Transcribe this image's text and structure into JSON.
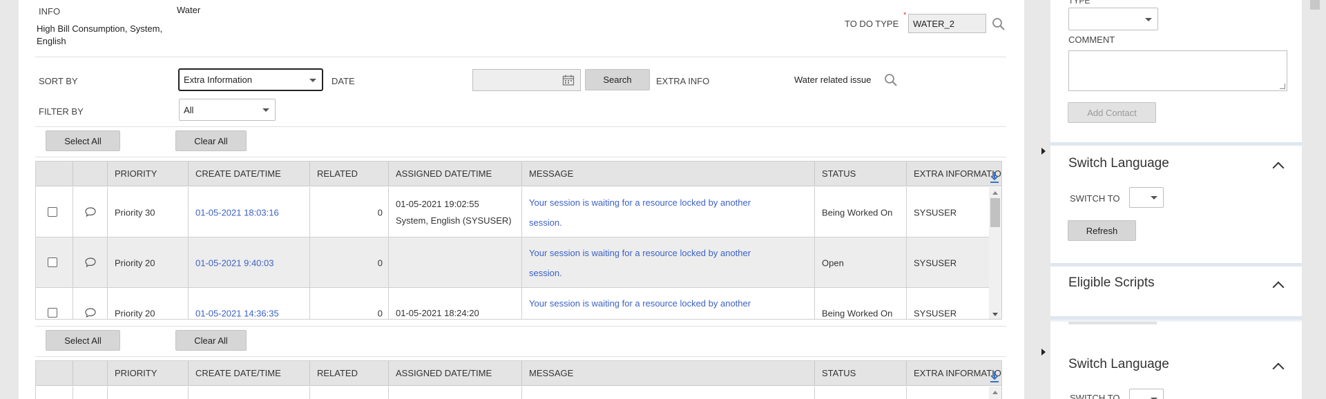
{
  "filters": {
    "info_label": "INFO",
    "info_type": "Water",
    "info_value": "High Bill Consumption, System, English",
    "todo_type_label": "TO DO TYPE",
    "todo_type_required": "*",
    "todo_type_value": "WATER_2",
    "sort_by_label": "SORT BY",
    "sort_by_value": "Extra Information",
    "date_label": "DATE",
    "search_button": "Search",
    "extra_info_label": "EXTRA INFO",
    "extra_info_value": "Water related issue",
    "filter_by_label": "FILTER BY",
    "filter_by_value": "All"
  },
  "actions": {
    "select_all": "Select All",
    "clear_all": "Clear All"
  },
  "table": {
    "columns": [
      "PRIORITY",
      "CREATE DATE/TIME",
      "RELATED",
      "ASSIGNED DATE/TIME",
      "MESSAGE",
      "STATUS",
      "EXTRA INFORMATION"
    ],
    "rows": [
      {
        "priority": "Priority 30",
        "create": "01-05-2021 18:03:16",
        "related": "0",
        "assigned": "01-05-2021 19:02:55",
        "assigned_by": "System, English (SYSUSER)",
        "message": "Your session is waiting for a resource locked by another session.",
        "status": "Being Worked On",
        "extra": "SYSUSER"
      },
      {
        "priority": "Priority 20",
        "create": "01-05-2021 9:40:03",
        "related": "0",
        "assigned": "",
        "assigned_by": "",
        "message": "Your session is waiting for a resource locked by another session.",
        "status": "Open",
        "extra": "SYSUSER"
      },
      {
        "priority": "Priority 20",
        "create": "01-05-2021 14:36:35",
        "related": "0",
        "assigned": "01-05-2021 18:24:20",
        "assigned_by": "",
        "message": "Your session is waiting for a resource locked by another session.",
        "status": "Being Worked On",
        "extra": "SYSUSER"
      }
    ],
    "second_row_message": "Your session is waiting for a resource locked by another"
  },
  "sidebar": {
    "type_label": "TYPE",
    "comment_label": "COMMENT",
    "add_contact_button": "Add Contact",
    "switch_language_title": "Switch Language",
    "switch_to_label": "SWITCH TO",
    "refresh_button": "Refresh",
    "eligible_scripts_title": "Eligible Scripts",
    "switch_language_title_2": "Switch Language",
    "switch_to_label_2": "SWITCH TO"
  }
}
